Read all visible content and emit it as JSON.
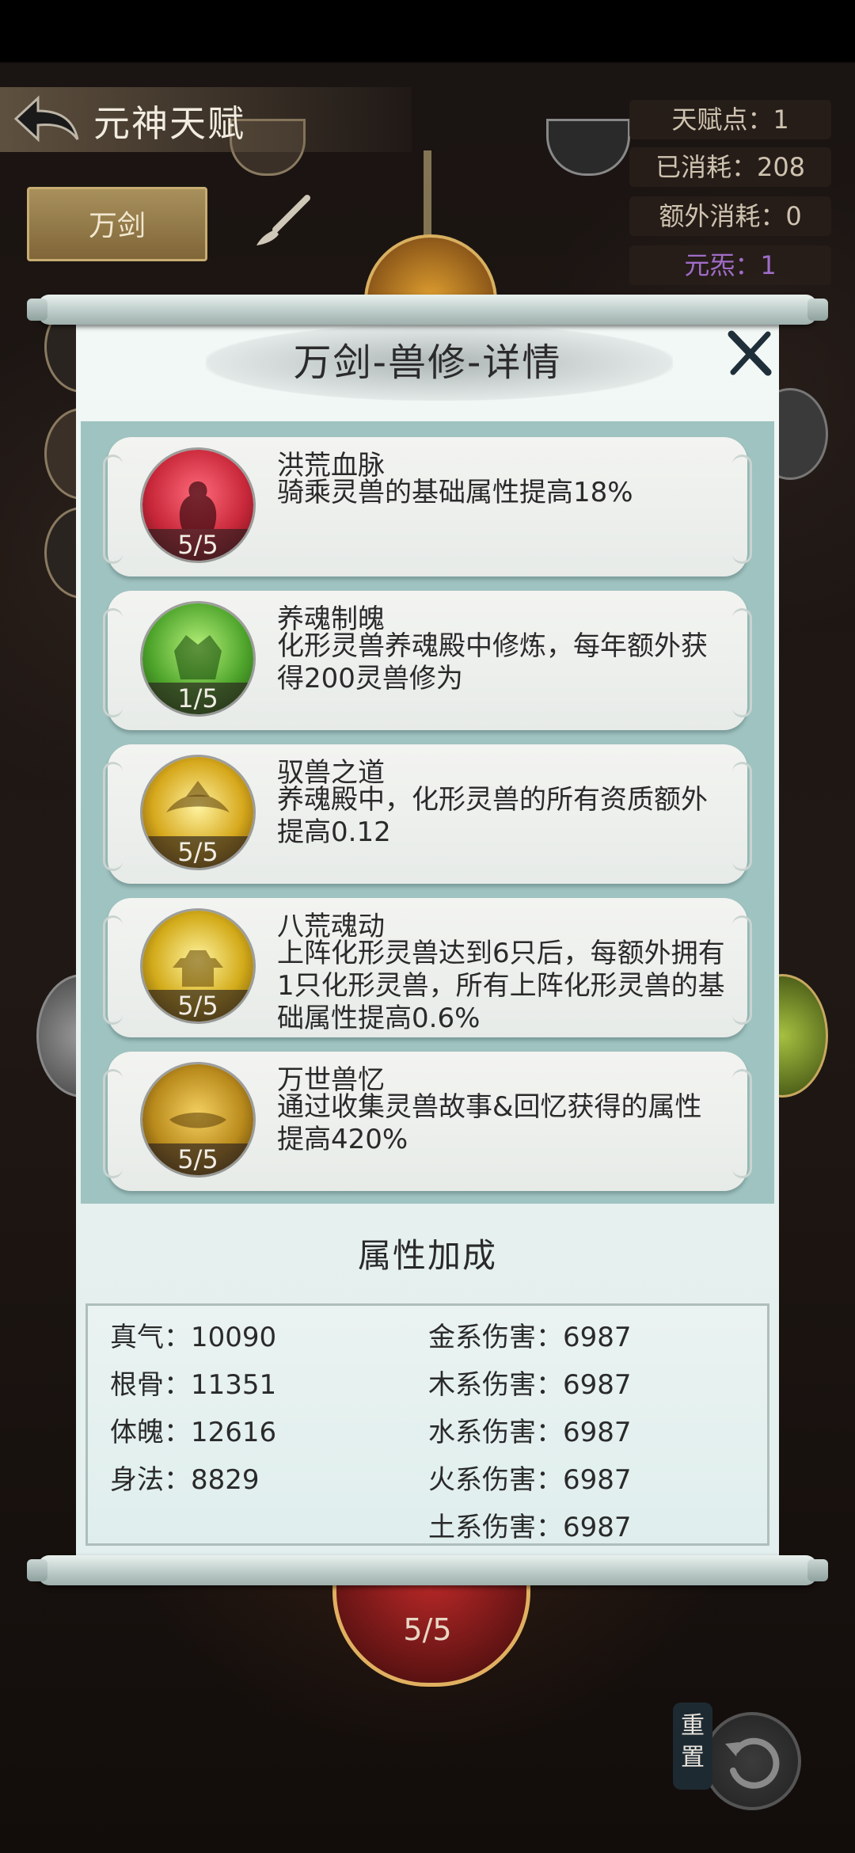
{
  "header": {
    "title": "元神天赋",
    "section_button": "万剑",
    "stats": [
      "天赋点：1",
      "已消耗：208",
      "额外消耗：0",
      "元炁：1"
    ]
  },
  "panel": {
    "title": "万剑-兽修-详情",
    "talents": [
      {
        "name": "洪荒血脉",
        "desc": "骑乘灵兽的基础属性提高18%",
        "level": "5/5",
        "color": "#c8283a"
      },
      {
        "name": "养魂制魄",
        "desc": "化形灵兽养魂殿中修炼，每年额外获得200灵兽修为",
        "level": "1/5",
        "color": "#4fa52c"
      },
      {
        "name": "驭兽之道",
        "desc": "养魂殿中，化形灵兽的所有资质额外提高0.12",
        "level": "5/5",
        "color": "#d6a81c"
      },
      {
        "name": "八荒魂动",
        "desc": "上阵化形灵兽达到6只后，每额外拥有1只化形灵兽，所有上阵化形灵兽的基础属性提高0.6%",
        "level": "5/5",
        "color": "#d3ab1a"
      },
      {
        "name": "万世兽忆",
        "desc": "通过收集灵兽故事&回忆获得的属性提高420%",
        "level": "5/5",
        "color": "#b98a1c"
      }
    ],
    "attr_heading": "属性加成",
    "attrs_left": [
      "真气：10090",
      "根骨：11351",
      "体魄：12616",
      "身法：8829"
    ],
    "attrs_right": [
      "金系伤害：6987",
      "木系伤害：6987",
      "水系伤害：6987",
      "火系伤害：6987",
      "土系伤害：6987"
    ]
  },
  "bottom": {
    "node_level": "5/5",
    "reset_label": "重置"
  }
}
